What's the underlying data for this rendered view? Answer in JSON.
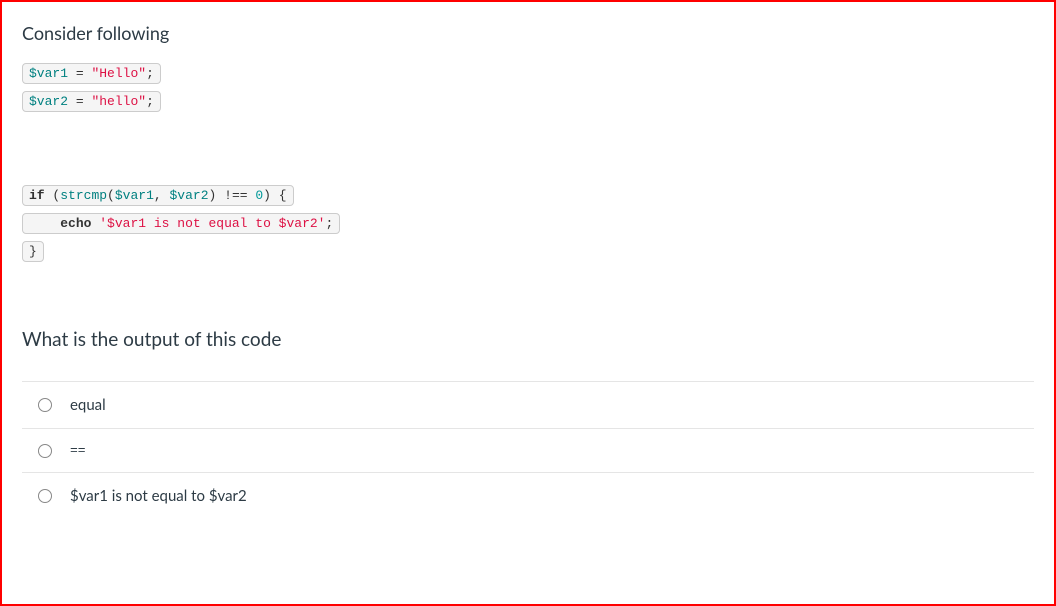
{
  "question": {
    "prompt": "Consider following",
    "code_lines": [
      {
        "html": "<span class='var'>$var1</span> <span class='op'>=</span> <span class='str'>\"Hello\"</span><span class='punc'>;</span>"
      },
      {
        "html": "<span class='var'>$var2</span> <span class='op'>=</span> <span class='str'>\"hello\"</span><span class='punc'>;</span>"
      }
    ],
    "code_block2": [
      {
        "html": "<span class='kw'>if</span> <span class='punc'>(</span><span class='fn'>strcmp</span><span class='punc'>(</span><span class='var'>$var1</span><span class='punc'>,</span> <span class='var'>$var2</span><span class='punc'>)</span> <span class='op'>!==</span> <span class='num'>0</span><span class='punc'>)</span> <span class='punc'>{</span>"
      },
      {
        "html": "    <span class='kw'>echo</span> <span class='strq'>'$var1 is not equal to $var2'</span><span class='punc'>;</span>"
      },
      {
        "html": "<span class='punc'>}</span>"
      }
    ],
    "subtext": "What is the output of this code"
  },
  "options": [
    {
      "label": "equal",
      "mono": false
    },
    {
      "label": "==",
      "mono": true
    },
    {
      "label": "$var1 is not equal to $var2",
      "mono": false
    }
  ]
}
